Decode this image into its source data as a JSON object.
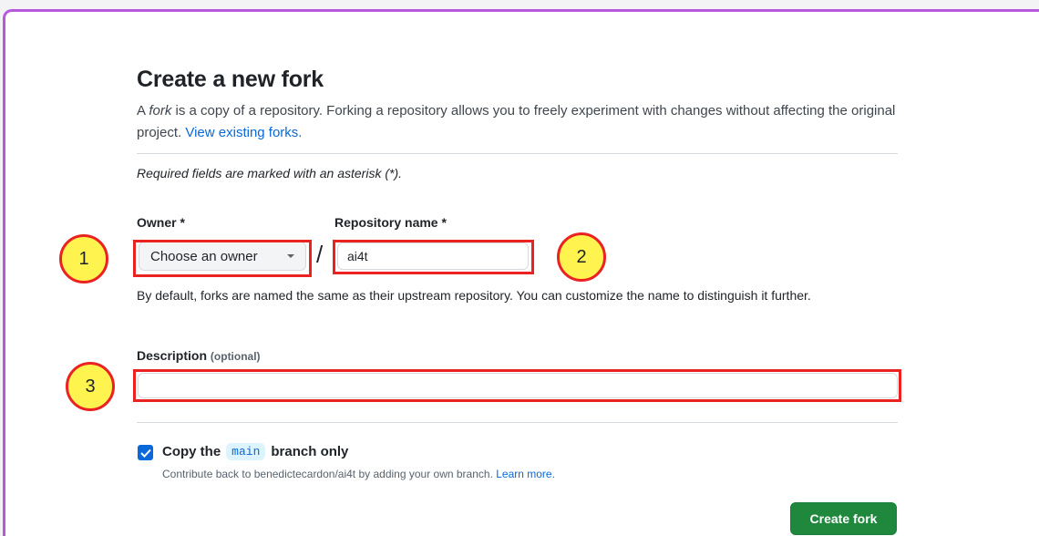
{
  "page": {
    "title": "Create a new fork",
    "intro_prefix": "A ",
    "intro_fork_word": "fork",
    "intro_rest": " is a copy of a repository. Forking a repository allows you to freely experiment with changes without affecting the original project. ",
    "view_forks_link": "View existing forks.",
    "required_note": "Required fields are marked with an asterisk (*)."
  },
  "owner": {
    "label": "Owner *",
    "select_value": "Choose an owner"
  },
  "separator": "/",
  "repository": {
    "label": "Repository name *",
    "value": "ai4t",
    "helper": "By default, forks are named the same as their upstream repository. You can customize the name to distinguish it further."
  },
  "description": {
    "label": "Description",
    "optional_tag": "(optional)",
    "value": ""
  },
  "copy_branch": {
    "checked": true,
    "label_prefix": "Copy the",
    "branch_name": "main",
    "label_suffix": "branch only",
    "hint_text": "Contribute back to benedictecardon/ai4t by adding your own branch. ",
    "learn_more_link": "Learn more."
  },
  "actions": {
    "create_label": "Create fork"
  },
  "annotations": {
    "markers": [
      "1",
      "2",
      "3"
    ],
    "circle_fill": "#fff44f",
    "outline_color": "#ea2222"
  },
  "colors": {
    "frame_border": "#b659dd",
    "link": "#0969da",
    "primary_button": "#1f883d",
    "checkbox": "#0969da"
  }
}
